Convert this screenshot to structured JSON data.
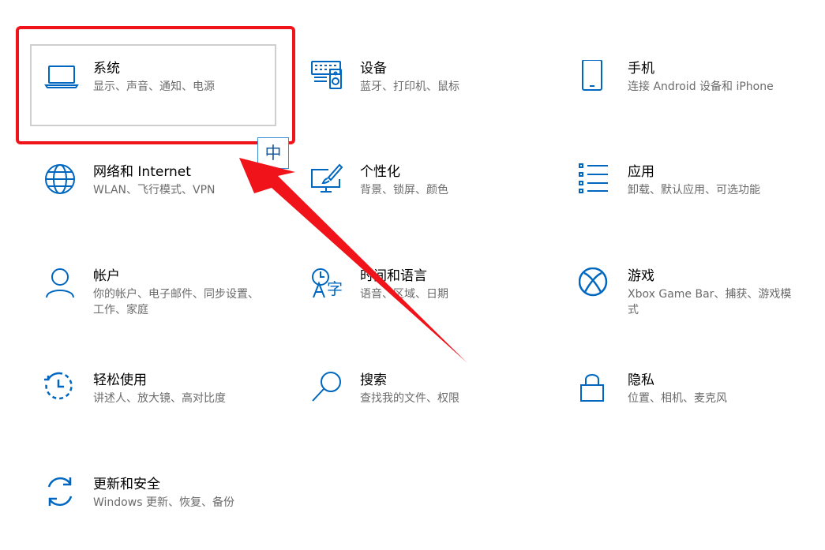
{
  "tiles": [
    {
      "title": "系统",
      "desc": "显示、声音、通知、电源"
    },
    {
      "title": "设备",
      "desc": "蓝牙、打印机、鼠标"
    },
    {
      "title": "手机",
      "desc": "连接 Android 设备和 iPhone"
    },
    {
      "title": "网络和 Internet",
      "desc": "WLAN、飞行模式、VPN"
    },
    {
      "title": "个性化",
      "desc": "背景、锁屏、颜色"
    },
    {
      "title": "应用",
      "desc": "卸载、默认应用、可选功能"
    },
    {
      "title": "帐户",
      "desc": "你的帐户、电子邮件、同步设置、工作、家庭"
    },
    {
      "title": "时间和语言",
      "desc": "语音、区域、日期"
    },
    {
      "title": "游戏",
      "desc": "Xbox Game Bar、捕获、游戏模式"
    },
    {
      "title": "轻松使用",
      "desc": "讲述人、放大镜、高对比度"
    },
    {
      "title": "搜索",
      "desc": "查找我的文件、权限"
    },
    {
      "title": "隐私",
      "desc": "位置、相机、麦克风"
    },
    {
      "title": "更新和安全",
      "desc": "Windows 更新、恢复、备份"
    }
  ],
  "ime_indicator": "中",
  "colors": {
    "accent": "#0067c0",
    "annotation": "#f0131a"
  }
}
